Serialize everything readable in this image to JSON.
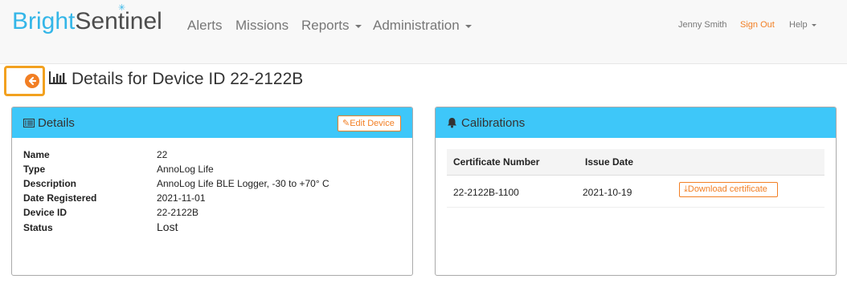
{
  "brand": {
    "part1": "Bright",
    "part2": "Sentinel",
    "star": "✳"
  },
  "nav": {
    "alerts": "Alerts",
    "missions": "Missions",
    "reports": "Reports",
    "administration": "Administration",
    "user": "Jenny Smith",
    "sign_out": "Sign Out",
    "help": "Help"
  },
  "page": {
    "title": "Details for Device ID 22-2122B"
  },
  "details": {
    "title": "Details",
    "edit_label": "Edit Device",
    "fields": [
      {
        "label": "Name",
        "value": "22"
      },
      {
        "label": "Type",
        "value": "AnnoLog Life"
      },
      {
        "label": "Description",
        "value": "AnnoLog Life BLE Logger, -30 to +70° C"
      },
      {
        "label": "Date Registered",
        "value": "2021-11-01"
      },
      {
        "label": "Device ID",
        "value": "22-2122B"
      },
      {
        "label": "Status",
        "value": "Lost"
      }
    ]
  },
  "calibrations": {
    "title": "Calibrations",
    "columns": [
      "Certificate Number",
      "Issue Date"
    ],
    "rows": [
      {
        "certificate": "22-2122B-1100",
        "issue_date": "2021-10-19",
        "action": "Download certificate"
      }
    ]
  },
  "colors": {
    "accent_blue": "#3ec7f9",
    "brand_blue": "#34b6e8",
    "orange": "#f27f24",
    "highlight": "#f2a11f"
  }
}
